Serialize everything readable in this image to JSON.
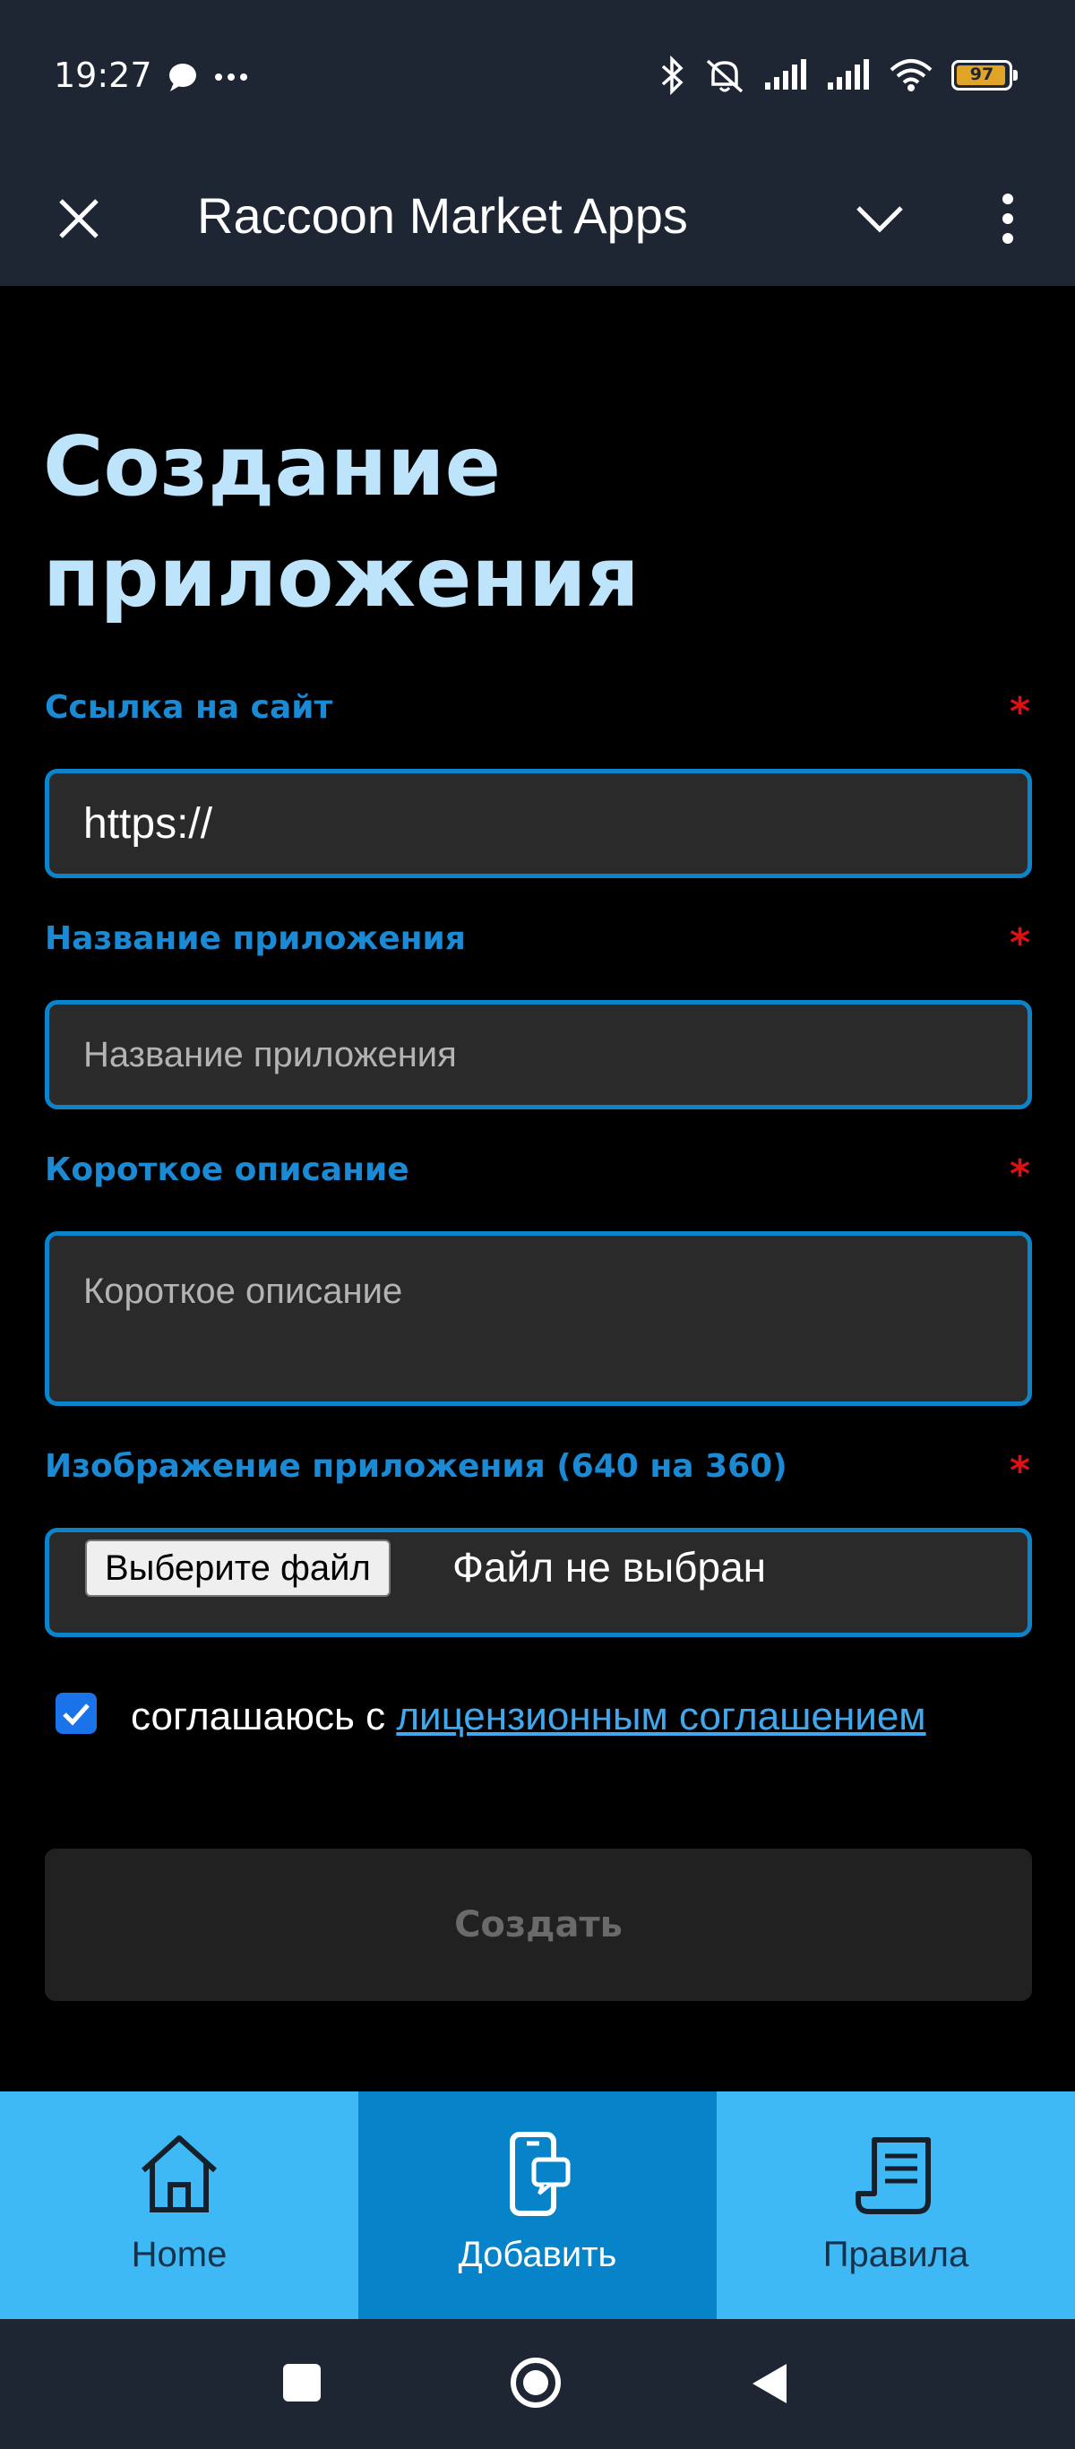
{
  "status_bar": {
    "time": "19:27",
    "battery": "97",
    "battery_level": 0.97
  },
  "app_bar": {
    "title": "Raccoon Market Apps"
  },
  "form": {
    "title": "Создание приложения",
    "url_label": "Ссылка на сайт",
    "url_value": "https://",
    "name_label": "Название приложения",
    "name_placeholder": "Название приложения",
    "desc_label": "Короткое описание",
    "desc_placeholder": "Короткое описание",
    "image_label": "Изображение приложения (640 на 360)",
    "file_button": "Выберите файл",
    "file_status": "Файл не выбран",
    "required_mark": "*",
    "agree_text": "соглашаюсь с ",
    "agree_link": "лицензионным соглашением",
    "agree_checked": true,
    "submit": "Создать"
  },
  "bottom_nav": {
    "items": [
      {
        "label": "Home",
        "icon": "home-icon"
      },
      {
        "label": "Добавить",
        "icon": "add-app-icon",
        "active": true
      },
      {
        "label": "Правила",
        "icon": "rules-scroll-icon"
      }
    ]
  },
  "colors": {
    "accent": "#0b84cc",
    "title": "#bde4fb",
    "nav_bg": "#3fb9f5",
    "nav_active": "#0784c9",
    "required": "#e01010"
  }
}
